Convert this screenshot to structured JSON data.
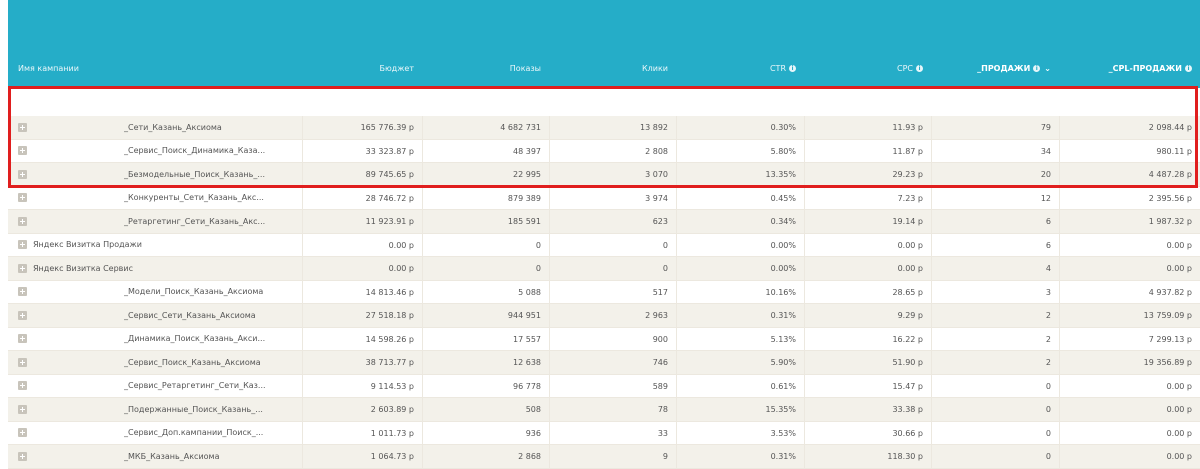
{
  "header": {
    "columns": [
      "Имя кампании",
      "Бюджет",
      "Показы",
      "Клики",
      "CTR",
      "CPC",
      "_ПРОДАЖИ",
      "_CPL-ПРОДАЖИ"
    ]
  },
  "rows": [
    {
      "name": "_Сети_Казань_Аксиома",
      "budget": "165 776.39 р",
      "impressions": "4 682 731",
      "clicks": "13 892",
      "ctr": "0.30%",
      "cpc": "11.93 р",
      "sales": "79",
      "cpl": "2 098.44 р",
      "indent": true
    },
    {
      "name": "_Сервис_Поиск_Динамика_Каза...",
      "budget": "33 323.87 р",
      "impressions": "48 397",
      "clicks": "2 808",
      "ctr": "5.80%",
      "cpc": "11.87 р",
      "sales": "34",
      "cpl": "980.11 р",
      "indent": true
    },
    {
      "name": "_Безмодельные_Поиск_Казань_...",
      "budget": "89 745.65 р",
      "impressions": "22 995",
      "clicks": "3 070",
      "ctr": "13.35%",
      "cpc": "29.23 р",
      "sales": "20",
      "cpl": "4 487.28 р",
      "indent": true
    },
    {
      "name": "_Конкуренты_Сети_Казань_Акс...",
      "budget": "28 746.72 р",
      "impressions": "879 389",
      "clicks": "3 974",
      "ctr": "0.45%",
      "cpc": "7.23 р",
      "sales": "12",
      "cpl": "2 395.56 р",
      "indent": true
    },
    {
      "name": "_Ретаргетинг_Сети_Казань_Акс...",
      "budget": "11 923.91 р",
      "impressions": "185 591",
      "clicks": "623",
      "ctr": "0.34%",
      "cpc": "19.14 р",
      "sales": "6",
      "cpl": "1 987.32 р",
      "indent": true
    },
    {
      "name": "Яндекс Визитка Продажи",
      "budget": "0.00 р",
      "impressions": "0",
      "clicks": "0",
      "ctr": "0.00%",
      "cpc": "0.00 р",
      "sales": "6",
      "cpl": "0.00 р",
      "indent": false
    },
    {
      "name": "Яндекс Визитка Сервис",
      "budget": "0.00 р",
      "impressions": "0",
      "clicks": "0",
      "ctr": "0.00%",
      "cpc": "0.00 р",
      "sales": "4",
      "cpl": "0.00 р",
      "indent": false
    },
    {
      "name": "_Модели_Поиск_Казань_Аксиома",
      "budget": "14 813.46 р",
      "impressions": "5 088",
      "clicks": "517",
      "ctr": "10.16%",
      "cpc": "28.65 р",
      "sales": "3",
      "cpl": "4 937.82 р",
      "indent": true
    },
    {
      "name": "_Сервис_Сети_Казань_Аксиома",
      "budget": "27 518.18 р",
      "impressions": "944 951",
      "clicks": "2 963",
      "ctr": "0.31%",
      "cpc": "9.29 р",
      "sales": "2",
      "cpl": "13 759.09 р",
      "indent": true
    },
    {
      "name": "_Динамика_Поиск_Казань_Акси...",
      "budget": "14 598.26 р",
      "impressions": "17 557",
      "clicks": "900",
      "ctr": "5.13%",
      "cpc": "16.22 р",
      "sales": "2",
      "cpl": "7 299.13 р",
      "indent": true
    },
    {
      "name": "_Сервис_Поиск_Казань_Аксиома",
      "budget": "38 713.77 р",
      "impressions": "12 638",
      "clicks": "746",
      "ctr": "5.90%",
      "cpc": "51.90 р",
      "sales": "2",
      "cpl": "19 356.89 р",
      "indent": true
    },
    {
      "name": "_Сервис_Ретаргетинг_Сети_Каз...",
      "budget": "9 114.53 р",
      "impressions": "96 778",
      "clicks": "589",
      "ctr": "0.61%",
      "cpc": "15.47 р",
      "sales": "0",
      "cpl": "0.00 р",
      "indent": true
    },
    {
      "name": "_Подержанные_Поиск_Казань_...",
      "budget": "2 603.89 р",
      "impressions": "508",
      "clicks": "78",
      "ctr": "15.35%",
      "cpc": "33.38 р",
      "sales": "0",
      "cpl": "0.00 р",
      "indent": true
    },
    {
      "name": "_Сервис_Доп.кампании_Поиск_...",
      "budget": "1 011.73 р",
      "impressions": "936",
      "clicks": "33",
      "ctr": "3.53%",
      "cpc": "30.66 р",
      "sales": "0",
      "cpl": "0.00 р",
      "indent": true
    },
    {
      "name": "_МКБ_Казань_Аксиома",
      "budget": "1 064.73 р",
      "impressions": "2 868",
      "clicks": "9",
      "ctr": "0.31%",
      "cpc": "118.30 р",
      "sales": "0",
      "cpl": "0.00 р",
      "indent": true
    }
  ]
}
